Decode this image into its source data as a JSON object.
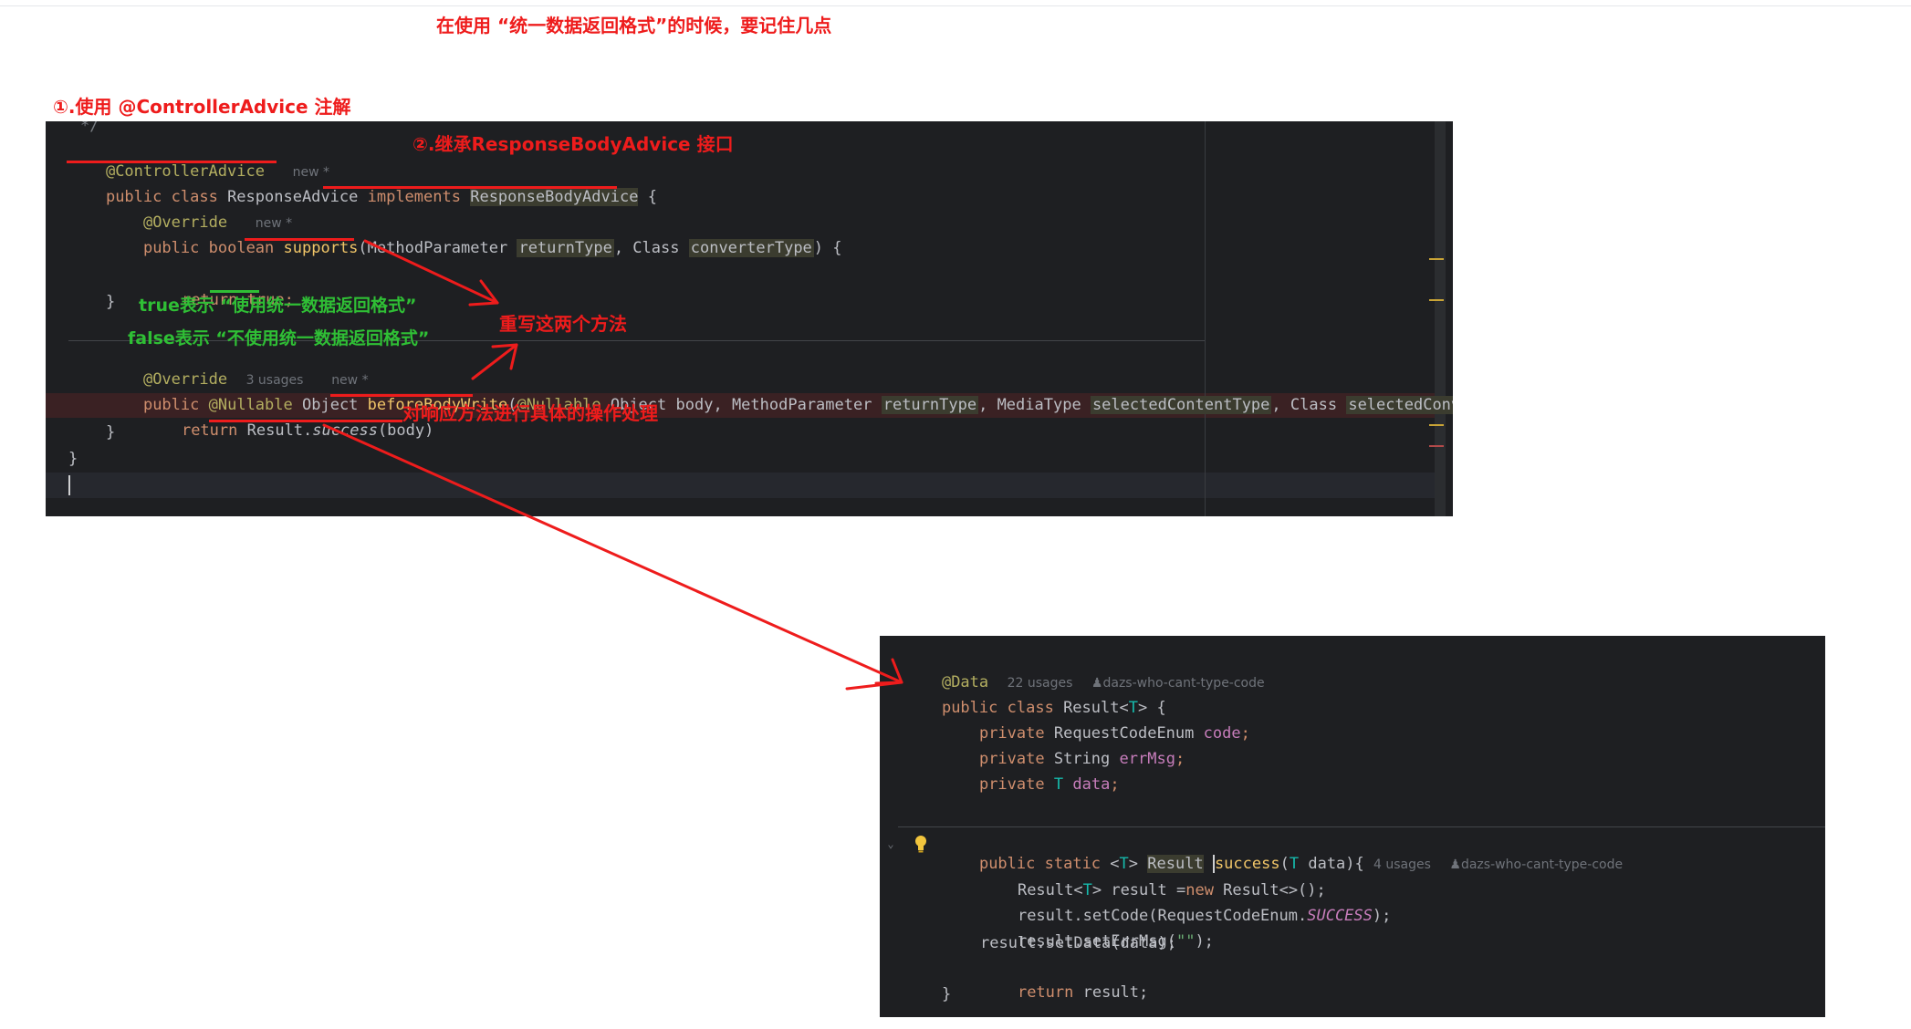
{
  "title": "在使用 “统一数据返回格式”的时候，要记住几点",
  "labels": {
    "step1": "①.使用 @ControllerAdvice 注解",
    "step2": "②.继承ResponseBodyAdvice 接口",
    "true_note": "true表示 “使用统一数据返回格式”",
    "false_note": "false表示 “不使用统一数据返回格式”",
    "override_note": "重写这两个方法",
    "operate_note": "对响应方法进行具体的操作处理"
  },
  "editor1": {
    "comment_end": "*/",
    "annotation": "@ControllerAdvice",
    "hint_new": "new *",
    "kw_public": "public",
    "kw_class": "class",
    "class_name": "ResponseAdvice",
    "kw_implements": "implements",
    "iface": "ResponseBodyAdvice",
    "open_brace": "{",
    "override": "@Override",
    "kw_boolean": "boolean",
    "m_supports": "supports",
    "t_method_param": "MethodParameter",
    "p_return_type": "returnType",
    "t_class": "Class",
    "p_converter_type": "converterType",
    "kw_return": "return",
    "v_true": "true;",
    "close_brace": "}",
    "hint_usages": "3 usages",
    "a_nullable": "@Nullable",
    "t_object": "Object",
    "m_before": "beforeBodyWrite",
    "p_body": "body",
    "t_media": "MediaType",
    "p_selected_ct": "selectedContentType",
    "p_selected_conv": "selectedConver",
    "result_call": "Result.",
    "m_success": "success",
    "body_arg": "(body)"
  },
  "editor2": {
    "annotation": "@Data",
    "hint_usages": "22 usages",
    "author": "dazs-who-cant-type-code",
    "kw_public": "public",
    "kw_class": "class",
    "class_decl": "Result<",
    "type_t": "T",
    "class_decl_end": "> {",
    "kw_private": "private",
    "t_code_enum": "RequestCodeEnum",
    "f_code": "code",
    "t_string": "String",
    "f_errmsg": "errMsg",
    "f_data": "data",
    "semi": ";",
    "kw_static": "static",
    "t_result": "Result",
    "m_success": "success",
    "p_data": "data",
    "hint_usages2": "4 usages",
    "line_result_new_a": "Result<",
    "line_result_new_b": "> result =",
    "kw_new": "new",
    "line_result_new_c": " Result<>();",
    "line_setcode_a": "result.setCode(RequestCodeEnum.",
    "c_success": "SUCCESS",
    "line_setcode_b": ");",
    "line_seterr_a": "result.setErrMsg(",
    "empty_str": "\"\"",
    "line_seterr_b": ");",
    "line_setdata": "result.setData(data);",
    "ret_var": " result;",
    "close_brace": "}"
  }
}
